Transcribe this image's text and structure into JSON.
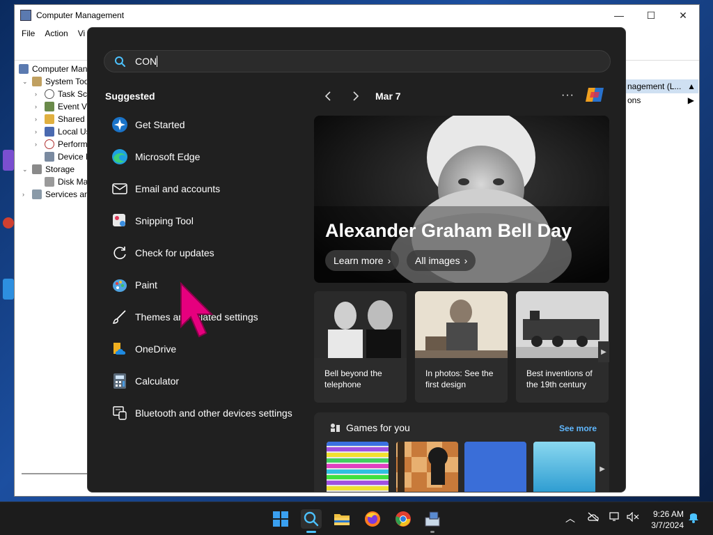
{
  "window": {
    "title": "Computer Management",
    "menu": [
      "File",
      "Action",
      "Vi"
    ],
    "controls": {
      "minimize": "—",
      "maximize": "☐",
      "close": "✕"
    },
    "tree": [
      {
        "label": "Computer Manag",
        "indent": 0,
        "arrow": ""
      },
      {
        "label": "System Tools",
        "indent": 1,
        "arrow": "⌄"
      },
      {
        "label": "Task Scheduler",
        "indent": 2,
        "arrow": "›"
      },
      {
        "label": "Event Viewer",
        "indent": 2,
        "arrow": "›"
      },
      {
        "label": "Shared Folders",
        "indent": 2,
        "arrow": "›"
      },
      {
        "label": "Local Users",
        "indent": 2,
        "arrow": "›"
      },
      {
        "label": "Performance",
        "indent": 2,
        "arrow": "›"
      },
      {
        "label": "Device Manager",
        "indent": 2,
        "arrow": ""
      },
      {
        "label": "Storage",
        "indent": 1,
        "arrow": "⌄"
      },
      {
        "label": "Disk Management",
        "indent": 2,
        "arrow": ""
      },
      {
        "label": "Services and",
        "indent": 1,
        "arrow": "›"
      }
    ],
    "actions_head": "nagement (L...",
    "actions_row": "ons"
  },
  "search": {
    "query": "CON",
    "suggested_label": "Suggested",
    "suggestions": [
      {
        "label": "Get Started",
        "icon": "get-started-icon"
      },
      {
        "label": "Microsoft Edge",
        "icon": "edge-icon"
      },
      {
        "label": "Email and accounts",
        "icon": "mail-icon"
      },
      {
        "label": "Snipping Tool",
        "icon": "snipping-tool-icon"
      },
      {
        "label": "Check for updates",
        "icon": "refresh-icon"
      },
      {
        "label": "Paint",
        "icon": "paint-icon"
      },
      {
        "label": "Themes and related settings",
        "icon": "brush-icon"
      },
      {
        "label": "OneDrive",
        "icon": "onedrive-icon"
      },
      {
        "label": "Calculator",
        "icon": "calculator-icon"
      },
      {
        "label": "Bluetooth and other devices settings",
        "icon": "bluetooth-devices-icon"
      }
    ],
    "date": "Mar 7",
    "more": "···",
    "hero": {
      "title": "Alexander Graham Bell Day",
      "learn_more": "Learn more",
      "all_images": "All images"
    },
    "cards": [
      {
        "title": "Bell beyond the telephone"
      },
      {
        "title": "In photos: See the first design"
      },
      {
        "title": "Best inventions of the 19th century"
      }
    ],
    "games": {
      "title": "Games for you",
      "see_more": "See more"
    }
  },
  "taskbar": {
    "time": "9:26 AM",
    "date": "3/7/2024"
  },
  "colors": {
    "panel_bg": "#202020",
    "accent_link": "#60b8ff",
    "cursor": "#e6007e"
  }
}
